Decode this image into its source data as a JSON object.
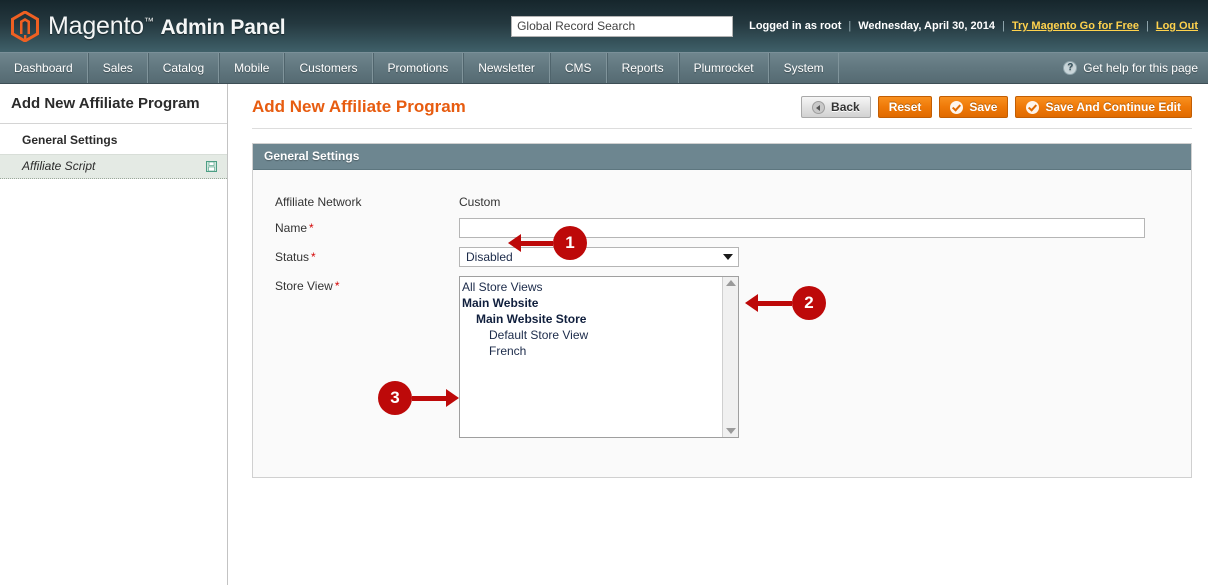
{
  "header": {
    "logo_text_light": "Magento",
    "logo_tm": "™",
    "logo_text_bold": "Admin Panel",
    "logo_icon": "magento-logo-icon",
    "search_placeholder": "Global Record Search",
    "search_value": "",
    "logged_in_as": "Logged in as root",
    "separator": "|",
    "date": "Wednesday, April 30, 2014",
    "try_magento_link": "Try Magento Go for Free",
    "logout_link": "Log Out"
  },
  "nav": {
    "items": [
      {
        "label": "Dashboard"
      },
      {
        "label": "Sales"
      },
      {
        "label": "Catalog"
      },
      {
        "label": "Mobile"
      },
      {
        "label": "Customers"
      },
      {
        "label": "Promotions"
      },
      {
        "label": "Newsletter"
      },
      {
        "label": "CMS"
      },
      {
        "label": "Reports"
      },
      {
        "label": "Plumrocket"
      },
      {
        "label": "System"
      }
    ],
    "help_label": "Get help for this page",
    "help_icon": "question-mark-icon"
  },
  "sidebar": {
    "title": "Add New Affiliate Program",
    "group_label": "General Settings",
    "item_label": "Affiliate Script",
    "item_icon": "floppy-disk-save-icon"
  },
  "content": {
    "page_title": "Add New Affiliate Program",
    "buttons": {
      "back": "Back",
      "reset": "Reset",
      "save": "Save",
      "save_continue": "Save And Continue Edit"
    },
    "fieldset_title": "General Settings",
    "fields": {
      "affiliate_network_label": "Affiliate Network",
      "affiliate_network_value": "Custom",
      "name_label": "Name",
      "name_value": "",
      "status_label": "Status",
      "status_value": "Disabled",
      "store_view_label": "Store View",
      "required_mark": "*"
    },
    "store_view_options": [
      {
        "label": "All Store Views",
        "level": 0,
        "bold": false
      },
      {
        "label": "Main Website",
        "level": 0,
        "bold": true
      },
      {
        "label": "Main Website Store",
        "level": 1,
        "bold": true
      },
      {
        "label": "Default Store View",
        "level": 2,
        "bold": false
      },
      {
        "label": "French",
        "level": 2,
        "bold": false
      }
    ]
  },
  "callouts": [
    {
      "number": "1",
      "direction": "left",
      "target": "name-input"
    },
    {
      "number": "2",
      "direction": "left",
      "target": "status-select"
    },
    {
      "number": "3",
      "direction": "right",
      "target": "store-view-multiselect"
    }
  ],
  "colors": {
    "accent_orange": "#e75c10",
    "header_dark": "#16262c",
    "nav_slate": "#61777f",
    "fieldset_header": "#6d8690",
    "callout_red": "#bd0909",
    "required_red": "#d40707",
    "link_yellow": "#ffd24d"
  }
}
